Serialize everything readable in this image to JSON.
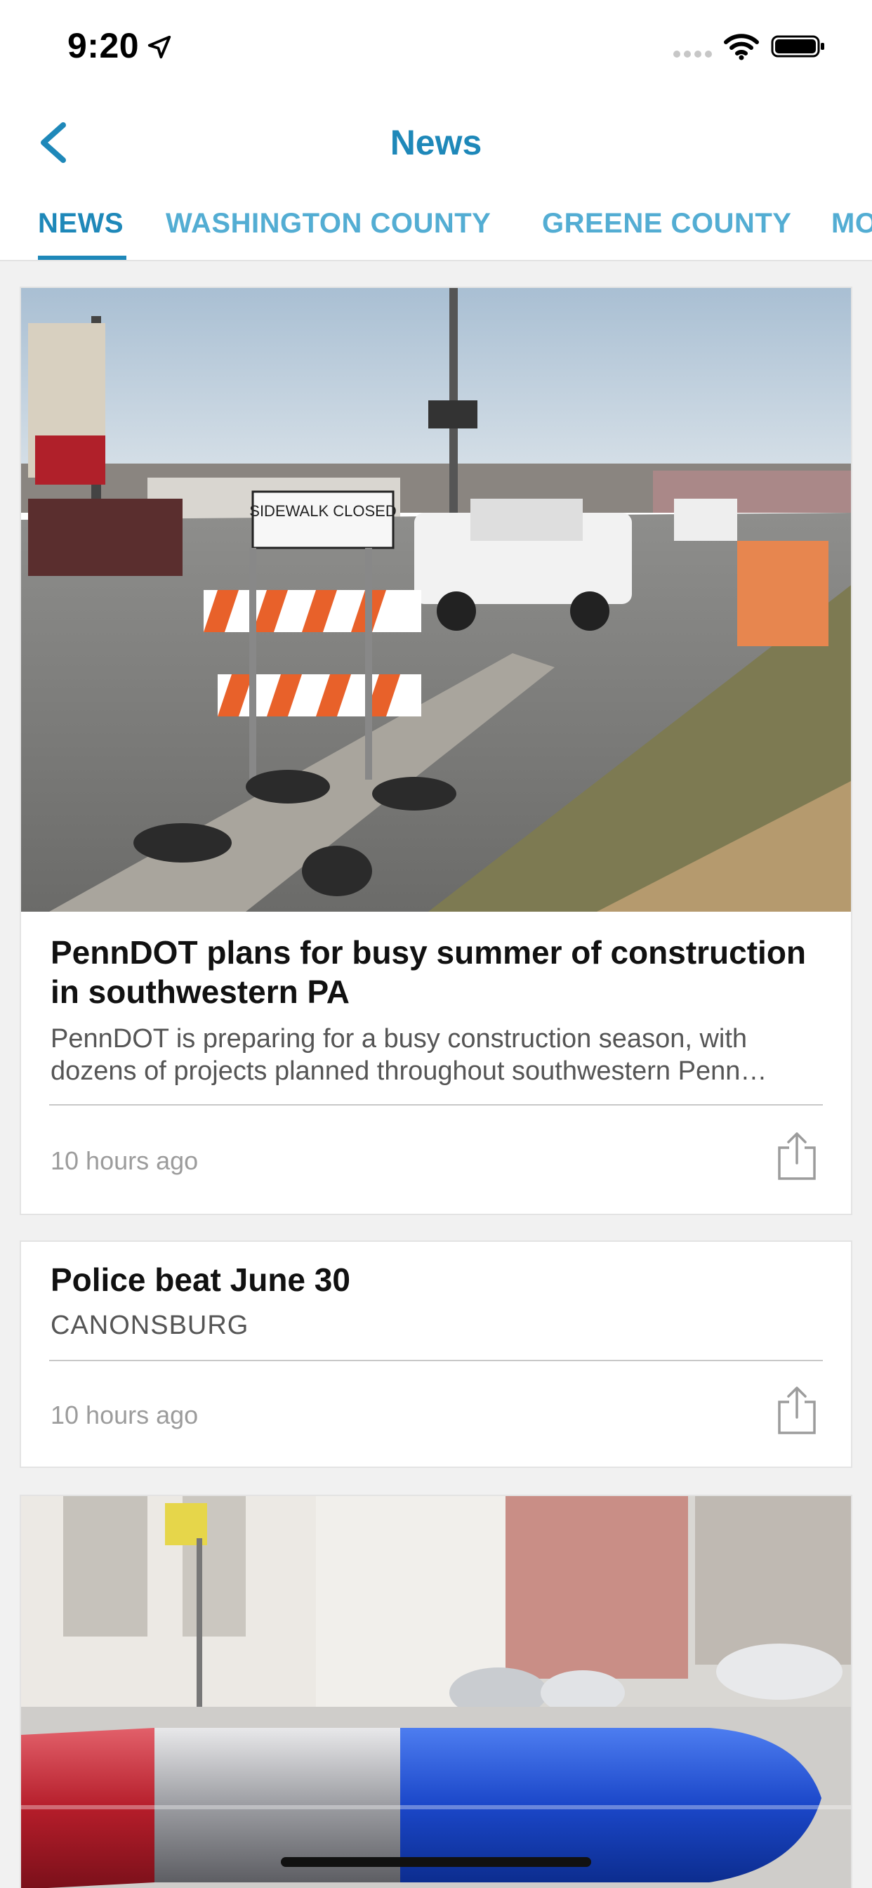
{
  "status_bar": {
    "time": "9:20",
    "icons": [
      "location-arrow-icon",
      "signal-dots-icon",
      "wifi-icon",
      "battery-icon"
    ]
  },
  "nav": {
    "title": "News",
    "back_icon": "chevron-left-icon"
  },
  "tabs": [
    {
      "label": "NEWS",
      "active": true
    },
    {
      "label": "WASHINGTON COUNTY",
      "active": false
    },
    {
      "label": "GREENE COUNTY",
      "active": false
    },
    {
      "label": "MO",
      "active": false
    }
  ],
  "articles": [
    {
      "image": "road-construction-barricade-photo",
      "title": "PennDOT plans for busy summer of construction in southwestern PA",
      "summary": "PennDOT is preparing for a busy construction season, with dozens of projects planned throughout southwestern Penn…",
      "time": "10 hours ago",
      "sign_text": "SIDEWALK CLOSED"
    },
    {
      "title": "Police beat June 30",
      "kicker": "CANONSBURG",
      "time": "10 hours ago"
    },
    {
      "image": "police-light-bar-street-photo"
    }
  ],
  "colors": {
    "accent": "#1e88b9",
    "tab_inactive": "#53add3",
    "text_primary": "#111111",
    "text_secondary": "#555555",
    "text_muted": "#9c9c9c",
    "background": "#f1f1f1"
  }
}
